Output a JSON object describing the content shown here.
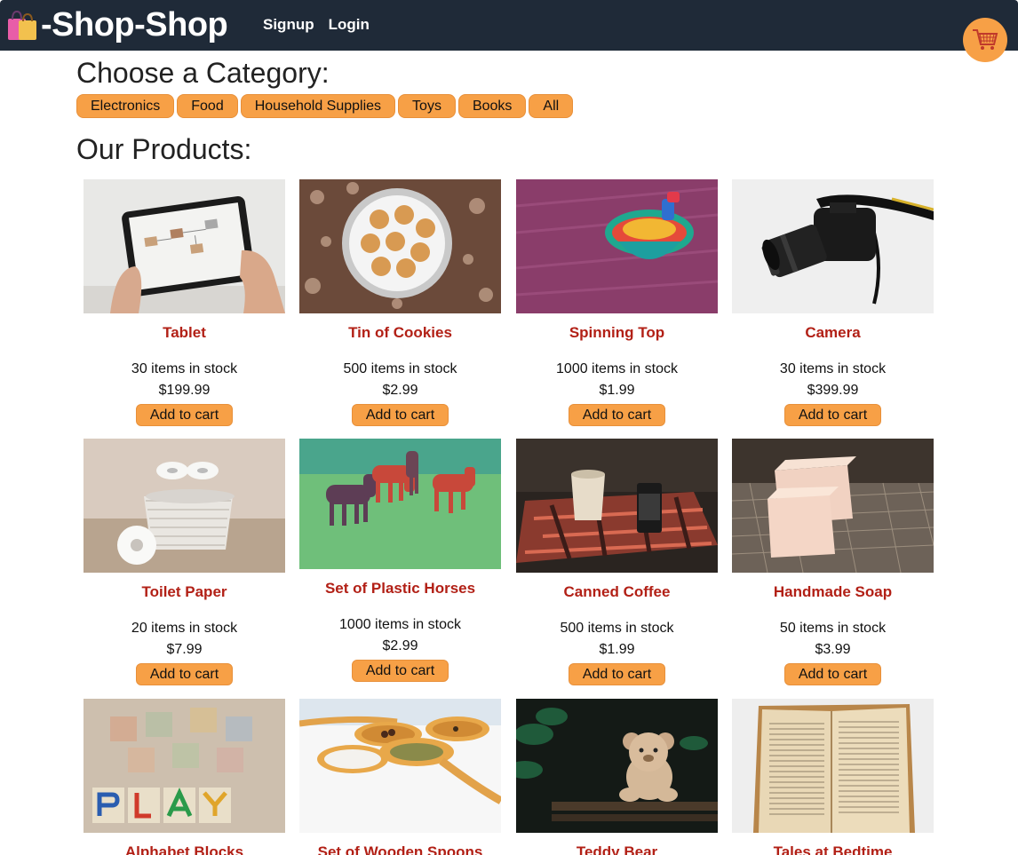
{
  "header": {
    "brand": "-Shop-Shop",
    "brand_icon": "shopping-bags-icon",
    "nav": [
      {
        "label": "Signup"
      },
      {
        "label": "Login"
      }
    ],
    "cart_icon": "shopping-cart-icon"
  },
  "category_section": {
    "title": "Choose a Category:",
    "categories": [
      "Electronics",
      "Food",
      "Household Supplies",
      "Toys",
      "Books",
      "All"
    ]
  },
  "products_section": {
    "title": "Our Products:",
    "add_label": "Add to cart",
    "products": [
      {
        "name": "Tablet",
        "stock": "30 items in stock",
        "price": "$199.99",
        "image": "tablet"
      },
      {
        "name": "Tin of Cookies",
        "stock": "500 items in stock",
        "price": "$2.99",
        "image": "cookies"
      },
      {
        "name": "Spinning Top",
        "stock": "1000 items in stock",
        "price": "$1.99",
        "image": "spinning-top"
      },
      {
        "name": "Camera",
        "stock": "30 items in stock",
        "price": "$399.99",
        "image": "camera"
      },
      {
        "name": "Toilet Paper",
        "stock": "20 items in stock",
        "price": "$7.99",
        "image": "toilet-paper"
      },
      {
        "name": "Set of Plastic Horses",
        "stock": "1000 items in stock",
        "price": "$2.99",
        "image": "plastic-horses"
      },
      {
        "name": "Canned Coffee",
        "stock": "500 items in stock",
        "price": "$1.99",
        "image": "canned-coffee"
      },
      {
        "name": "Handmade Soap",
        "stock": "50 items in stock",
        "price": "$3.99",
        "image": "soap"
      },
      {
        "name": "Alphabet Blocks",
        "image": "alphabet-blocks"
      },
      {
        "name": "Set of Wooden Spoons",
        "image": "wooden-spoons"
      },
      {
        "name": "Teddy Bear",
        "image": "teddy-bear"
      },
      {
        "name": "Tales at Bedtime",
        "image": "book"
      }
    ]
  },
  "colors": {
    "topbar": "#1f2a38",
    "accent": "#f7a046",
    "product_name": "#b22016"
  }
}
